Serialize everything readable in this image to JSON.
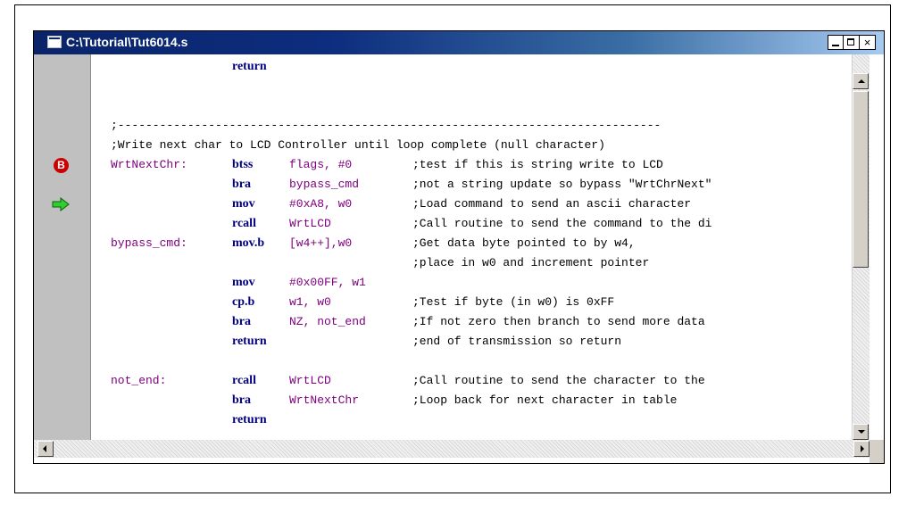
{
  "window": {
    "title": "C:\\Tutorial\\Tut6014.s",
    "close_glyph": "×"
  },
  "icons": {
    "app": "document-icon",
    "breakpoint": "breakpoint-icon",
    "breakpoint_letter": "B",
    "execution_pointer": "green-arrow-icon"
  },
  "colors": {
    "label": "#800080",
    "mnemonic": "#000080",
    "comment": "#000000",
    "breakpoint": "#cc0000",
    "arrow": "#33cc33"
  },
  "code": [
    {
      "label": "",
      "mnemonic": "return",
      "operands": "",
      "comment": ""
    },
    {
      "label": "",
      "mnemonic": "",
      "operands": "",
      "comment": ""
    },
    {
      "label": "",
      "mnemonic": "",
      "operands": "",
      "comment": ""
    },
    {
      "full_comment": ";------------------------------------------------------------------------------"
    },
    {
      "full_comment": ";Write next char to LCD Controller until loop complete (null character)"
    },
    {
      "label": "WrtNextChr:",
      "mnemonic": "btss",
      "operands": "flags, #0",
      "comment": ";test if this is string write to LCD",
      "marker": "breakpoint"
    },
    {
      "label": "",
      "mnemonic": "bra",
      "operands": "bypass_cmd",
      "comment": ";not a string update so bypass \"WrtChrNext\""
    },
    {
      "label": "",
      "mnemonic": "mov",
      "operands": "#0xA8, w0",
      "comment": ";Load command to send an ascii character",
      "marker": "arrow"
    },
    {
      "label": "",
      "mnemonic": "rcall",
      "operands": "WrtLCD",
      "comment": ";Call routine to send the command to the di"
    },
    {
      "label": "bypass_cmd:",
      "mnemonic": "mov.b",
      "operands": "[w4++],w0",
      "comment": ";Get data byte pointed to by w4,"
    },
    {
      "label": "",
      "mnemonic": "",
      "operands": "",
      "comment": ";place in w0 and increment pointer"
    },
    {
      "label": "",
      "mnemonic": "mov",
      "operands": "#0x00FF, w1",
      "comment": ""
    },
    {
      "label": "",
      "mnemonic": "cp.b",
      "operands": "w1, w0",
      "comment": ";Test if byte (in w0) is 0xFF"
    },
    {
      "label": "",
      "mnemonic": "bra",
      "operands": "NZ, not_end",
      "comment": ";If not zero then branch to send more data"
    },
    {
      "label": "",
      "mnemonic": "return",
      "operands": "",
      "comment": ";end of transmission so return"
    },
    {
      "label": "",
      "mnemonic": "",
      "operands": "",
      "comment": ""
    },
    {
      "label": "not_end:",
      "mnemonic": "rcall",
      "operands": "WrtLCD",
      "comment": ";Call routine to send the character to the"
    },
    {
      "label": "",
      "mnemonic": "bra",
      "operands": "WrtNextChr",
      "comment": ";Loop back for next character in table"
    },
    {
      "label": "",
      "mnemonic": "return",
      "operands": "",
      "comment": ""
    }
  ]
}
